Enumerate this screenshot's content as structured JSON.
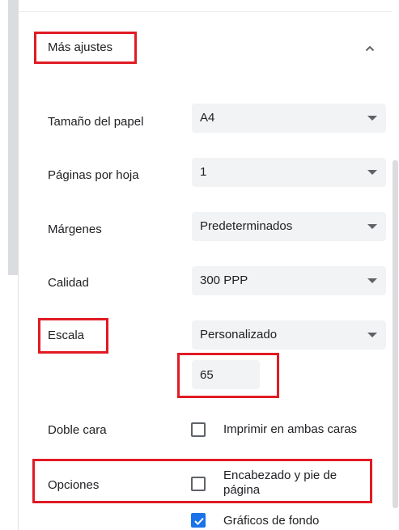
{
  "section": {
    "title": "Más ajustes",
    "collapse_icon": "chevron-up-icon"
  },
  "settings": {
    "paper_size": {
      "label": "Tamaño del papel",
      "value": "A4"
    },
    "pages_per_sheet": {
      "label": "Páginas por hoja",
      "value": "1"
    },
    "margins": {
      "label": "Márgenes",
      "value": "Predeterminados"
    },
    "quality": {
      "label": "Calidad",
      "value": "300 PPP"
    },
    "scale": {
      "label": "Escala",
      "value": "Personalizado",
      "custom_value": "65"
    },
    "duplex": {
      "label": "Doble cara",
      "option": "Imprimir en ambas caras",
      "checked": false
    },
    "options": {
      "label": "Opciones",
      "items": [
        {
          "label_line1": "Encabezado y pie de",
          "label_line2": "página",
          "checked": false
        },
        {
          "label": "Gráficos de fondo",
          "checked": true
        }
      ]
    }
  },
  "colors": {
    "highlight": "#e01b24",
    "checkbox_checked": "#1a73e8",
    "select_background": "#f1f3f4"
  }
}
